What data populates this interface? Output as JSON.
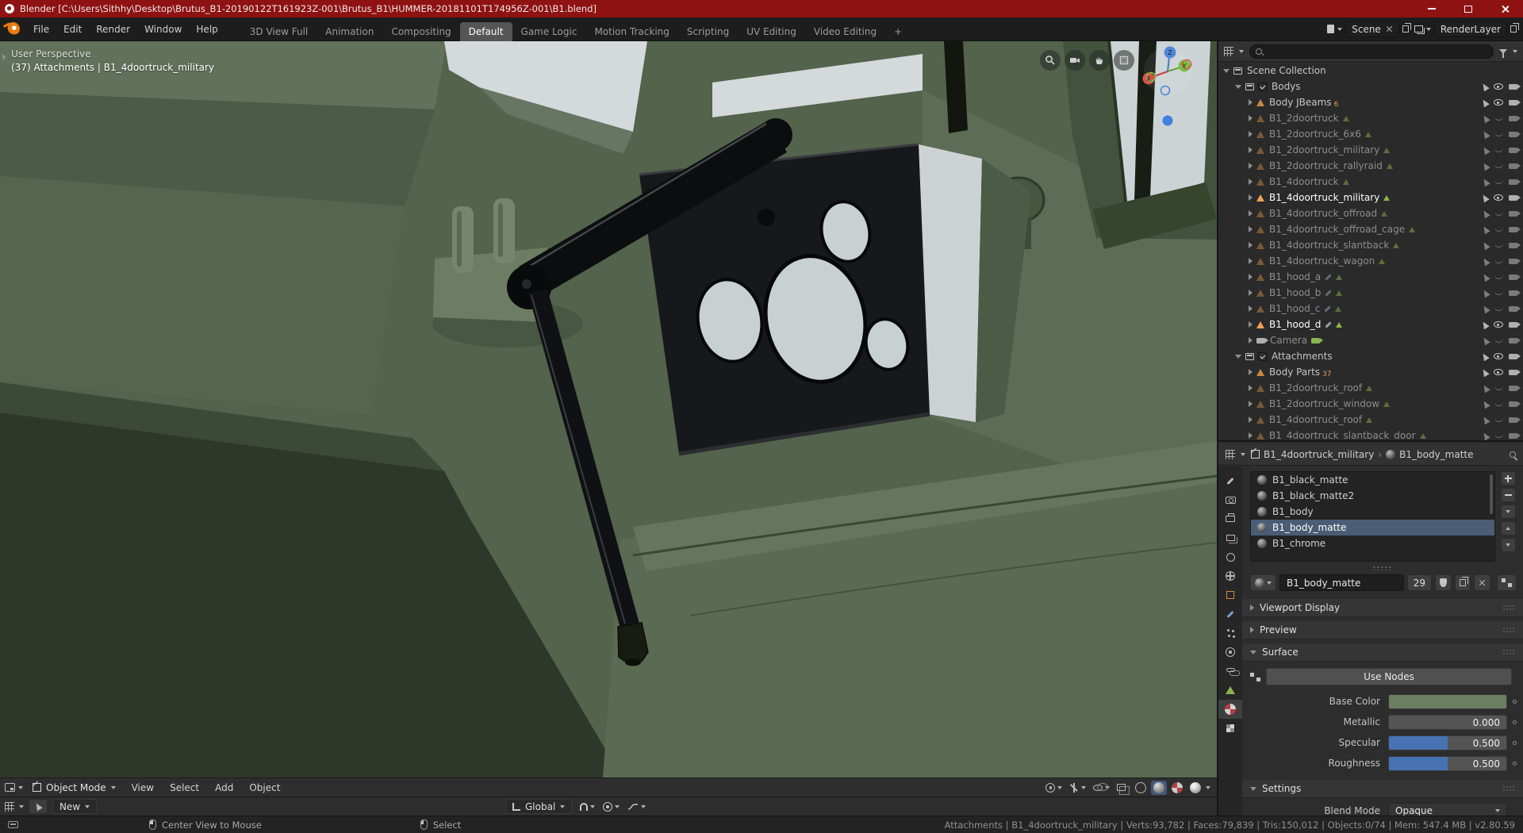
{
  "window": {
    "title": "Blender [C:\\Users\\Sithhy\\Desktop\\Brutus_B1-20190122T161923Z-001\\Brutus_B1\\HUMMER-20181101T174956Z-001\\B1.blend]"
  },
  "menubar": {
    "menus": [
      "File",
      "Edit",
      "Render",
      "Window",
      "Help"
    ],
    "tabs": [
      "3D View Full",
      "Animation",
      "Compositing",
      "Default",
      "Game Logic",
      "Motion Tracking",
      "Scripting",
      "UV Editing",
      "Video Editing",
      "+"
    ],
    "active_tab": "Default",
    "scene_name": "Scene",
    "render_layer": "RenderLayer"
  },
  "viewport": {
    "overlay_line1": "User Perspective",
    "overlay_line2": "(37) Attachments | B1_4doortruck_military",
    "mode": "Object Mode",
    "menus": [
      "View",
      "Select",
      "Add",
      "Object"
    ],
    "gizmo_axes": [
      "X",
      "Y",
      "Z"
    ],
    "tool": "New",
    "orientation": "Global"
  },
  "outliner": {
    "rows": [
      {
        "label": "Scene Collection"
      },
      {
        "label": "Bodys"
      },
      {
        "label": "Body JBeams",
        "badge": "6"
      },
      {
        "label": "B1_2doortruck"
      },
      {
        "label": "B1_2doortruck_6x6"
      },
      {
        "label": "B1_2doortruck_military"
      },
      {
        "label": "B1_2doortruck_rallyraid"
      },
      {
        "label": "B1_4doortruck"
      },
      {
        "label": "B1_4doortruck_military"
      },
      {
        "label": "B1_4doortruck_offroad"
      },
      {
        "label": "B1_4doortruck_offroad_cage"
      },
      {
        "label": "B1_4doortruck_slantback"
      },
      {
        "label": "B1_4doortruck_wagon"
      },
      {
        "label": "B1_hood_a"
      },
      {
        "label": "B1_hood_b"
      },
      {
        "label": "B1_hood_c"
      },
      {
        "label": "B1_hood_d"
      },
      {
        "label": "Camera"
      },
      {
        "label": "Attachments"
      },
      {
        "label": "Body Parts",
        "badge": "37"
      },
      {
        "label": "B1_2doortruck_roof"
      },
      {
        "label": "B1_2doortruck_window"
      },
      {
        "label": "B1_4doortruck_roof"
      },
      {
        "label": "B1_4doortruck_slantback_door"
      }
    ]
  },
  "properties": {
    "breadcrumb_object": "B1_4doortruck_military",
    "breadcrumb_separator": "›",
    "breadcrumb_material": "B1_body_matte",
    "material_slots": [
      "B1_black_matte",
      "B1_black_matte2",
      "B1_body",
      "B1_body_matte",
      "B1_chrome"
    ],
    "selected_slot": "B1_body_matte",
    "datablock_name": "B1_body_matte",
    "users_count": "29",
    "panels": {
      "viewport_display": "Viewport Display",
      "preview": "Preview",
      "surface": "Surface",
      "settings": "Settings"
    },
    "surface": {
      "use_nodes": "Use Nodes",
      "base_color_label": "Base Color",
      "base_color_style": "background:#6b7e62",
      "metallic_label": "Metallic",
      "metallic_value": "0.000",
      "specular_label": "Specular",
      "specular_value": "0.500",
      "roughness_label": "Roughness",
      "roughness_value": "0.500"
    },
    "settings": {
      "blend_mode_label": "Blend Mode",
      "blend_mode_value": "Opaque"
    }
  },
  "statusbar": {
    "hint1": "Center View to Mouse",
    "hint2": "Select",
    "stats": "Attachments | B1_4doortruck_military | Verts:93,782 | Faces:79,839 | Tris:150,012 | Objects:0/74 | Mem: 547.4 MB | v2.80.59"
  },
  "colors": {
    "titlebar": "#8e1212",
    "accent": "#4772b3",
    "selection": "#4b5d75",
    "object_orange": "#c9873e",
    "mesh_green": "#8ab44e",
    "base_color_swatch": "#6b7e62"
  }
}
